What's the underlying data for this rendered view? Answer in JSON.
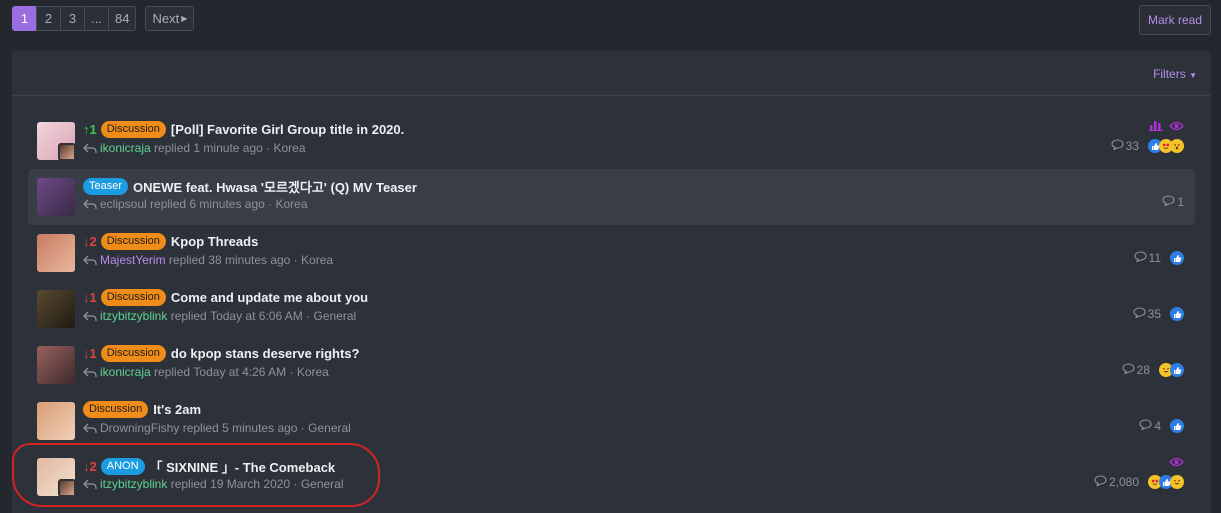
{
  "pagination": {
    "pages": [
      "1",
      "2",
      "3",
      "...",
      "84"
    ],
    "next_label": "Next"
  },
  "toolbar": {
    "mark_read_label": "Mark read",
    "filters_label": "Filters"
  },
  "threads": [
    {
      "rank": "1",
      "rank_dir": "up",
      "label": "Discussion",
      "title": "[Poll] Favorite Girl Group title in 2020.",
      "user": "ikonicraja",
      "user_color": "green",
      "action": "replied",
      "time": "1 minute ago",
      "forum": "Korea",
      "replies": "33",
      "reactions": [
        "like",
        "love",
        "wow"
      ],
      "top_icons": [
        "poll-icon",
        "watch-icon"
      ]
    },
    {
      "rank": "",
      "rank_dir": "",
      "label": "Teaser",
      "title": "ONEWE feat. Hwasa '모르겠다고' (Q) MV Teaser",
      "user": "eclipsoul",
      "user_color": "grey",
      "action": "replied",
      "time": "6 minutes ago",
      "forum": "Korea",
      "replies": "1",
      "reactions": [],
      "top_icons": []
    },
    {
      "rank": "2",
      "rank_dir": "down",
      "label": "Discussion",
      "title": "Kpop Threads",
      "user": "MajestYerim",
      "user_color": "purple",
      "action": "replied",
      "time": "38 minutes ago",
      "forum": "Korea",
      "replies": "11",
      "reactions": [
        "like"
      ],
      "top_icons": []
    },
    {
      "rank": "1",
      "rank_dir": "down",
      "label": "Discussion",
      "title": "Come and update me about you",
      "user": "itzybitzyblink",
      "user_color": "green",
      "action": "replied",
      "time": "Today at 6:06 AM",
      "forum": "General",
      "replies": "35",
      "reactions": [
        "like"
      ],
      "top_icons": []
    },
    {
      "rank": "1",
      "rank_dir": "down",
      "label": "Discussion",
      "title": "do kpop stans deserve rights?",
      "user": "ikonicraja",
      "user_color": "green",
      "action": "replied",
      "time": "Today at 4:26 AM",
      "forum": "Korea",
      "replies": "28",
      "reactions": [
        "haha",
        "like"
      ],
      "top_icons": []
    },
    {
      "rank": "",
      "rank_dir": "",
      "label": "Discussion",
      "title": "It's 2am",
      "user": "DrowningFishy",
      "user_color": "grey",
      "action": "replied",
      "time": "5 minutes ago",
      "forum": "General",
      "replies": "4",
      "reactions": [
        "like"
      ],
      "top_icons": []
    },
    {
      "rank": "2",
      "rank_dir": "down",
      "label": "ANON",
      "title": "「 SIXNINE 」- The Comeback",
      "user": "itzybitzyblink",
      "user_color": "green",
      "action": "replied",
      "time": "19 March 2020",
      "forum": "General",
      "replies": "2,080",
      "reactions": [
        "love",
        "like",
        "haha"
      ],
      "top_icons": [
        "watch-icon"
      ]
    }
  ],
  "colors": {
    "accent": "#9a6ee0",
    "discussion_label": "#f08c1a",
    "teaser_label": "#1b9be0",
    "rank_up": "#42c44f",
    "rank_down": "#e0443c",
    "annotation_circle": "#d32424"
  }
}
